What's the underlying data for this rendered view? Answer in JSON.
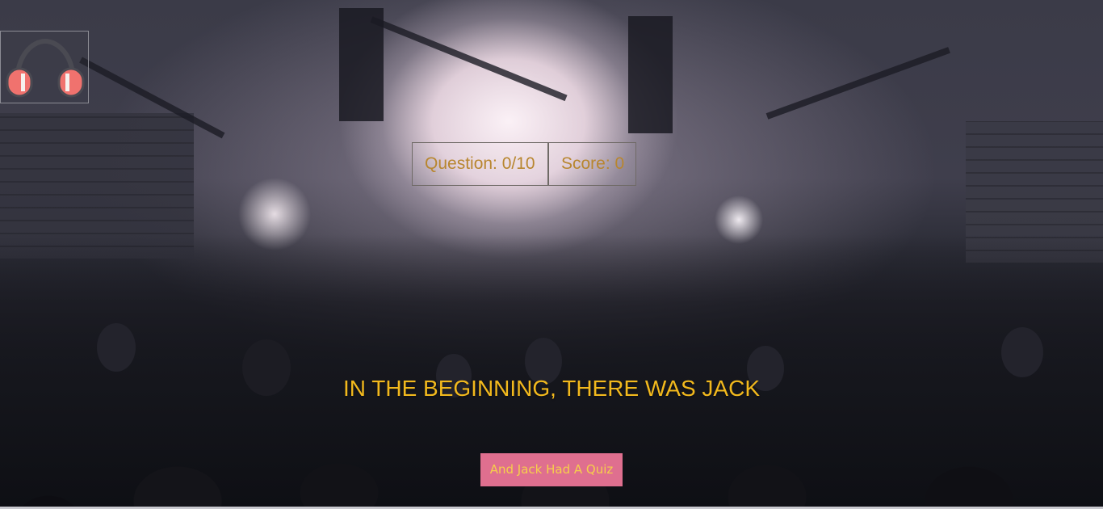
{
  "audio": {
    "icon": "headphones-icon",
    "accent_color": "#f0726e"
  },
  "stats": {
    "question_label": "Question: 0/10",
    "score_label": "Score: 0"
  },
  "headline": "IN THE BEGINNING, THERE WAS JACK",
  "start_button": {
    "label": "And Jack Had A Quiz",
    "background": "#df6f8f",
    "text_color": "#f6cf4a"
  },
  "colors": {
    "stat_text": "#b8862f",
    "headline_text": "#f2b91d"
  }
}
